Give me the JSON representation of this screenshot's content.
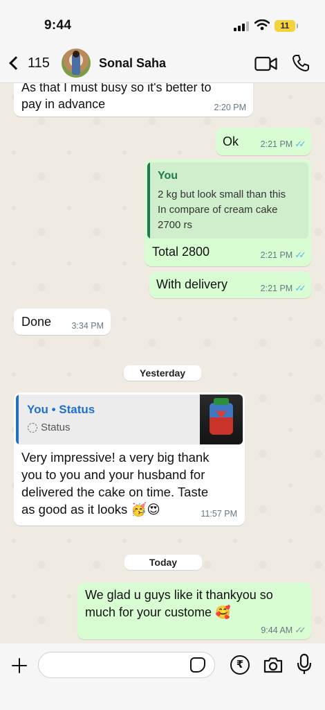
{
  "status_bar": {
    "time": "9:44",
    "battery": "11"
  },
  "header": {
    "back_count": "115",
    "contact_name": "Sonal Saha"
  },
  "messages": {
    "m1": {
      "text_line1": "As that I must busy so it's better to",
      "text_line2": "pay in advance",
      "time": "2:20 PM"
    },
    "m2": {
      "text": "Ok",
      "time": "2:21 PM"
    },
    "m3": {
      "quote_author": "You",
      "quote_line1": "2 kg but look small than this",
      "quote_line2": "In compare of cream cake",
      "quote_line3": "2700 rs",
      "text": "Total 2800",
      "time": "2:21 PM"
    },
    "m4": {
      "text": "With delivery",
      "time": "2:21 PM"
    },
    "m5": {
      "text": "Done",
      "time": "3:34 PM"
    },
    "day1": "Yesterday",
    "m6": {
      "quote_author": "You • Status",
      "quote_subtitle": "Status",
      "line1": "Very impressive! a very big thank",
      "line2": "you to you and your husband for",
      "line3": "delivered the cake on time. Taste",
      "line4": "as good as it looks 🥳😍",
      "time": "11:57 PM"
    },
    "day2": "Today",
    "m7": {
      "line1": "We glad u guys like it thankyou so",
      "line2": "much for your custome 🥰",
      "time": "9:44 AM"
    }
  },
  "composer": {
    "placeholder": ""
  },
  "colors": {
    "outgoing": "#d9fdd3",
    "incoming": "#ffffff",
    "read_ticks": "#53bdeb",
    "quote_bar": "#1f7a4d",
    "status_bar": "#1f6fd1"
  },
  "icons": [
    "back-chevron",
    "video-call",
    "voice-call",
    "plus",
    "sticker",
    "rupee-payment",
    "camera",
    "microphone"
  ]
}
